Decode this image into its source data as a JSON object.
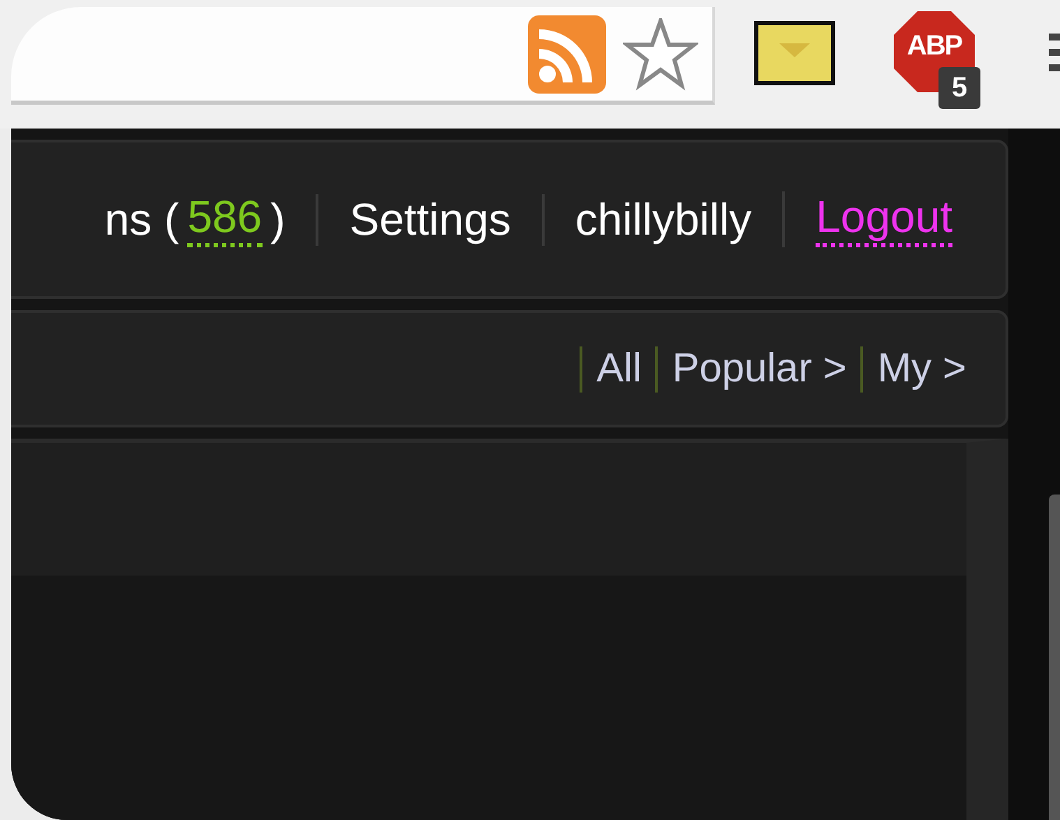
{
  "toolbar": {
    "sign_text": "ABP",
    "badge_count": "5"
  },
  "top_nav": {
    "items": [
      {
        "kind": "count",
        "prefix": "ns (",
        "count": "586",
        "suffix": ")"
      },
      {
        "kind": "link",
        "label": "Settings"
      },
      {
        "kind": "link",
        "label": "chillybilly"
      },
      {
        "kind": "logout",
        "label": "Logout"
      }
    ]
  },
  "filter_nav": {
    "items": [
      {
        "label": "All"
      },
      {
        "label": "Popular >"
      },
      {
        "label": "My >"
      }
    ]
  }
}
